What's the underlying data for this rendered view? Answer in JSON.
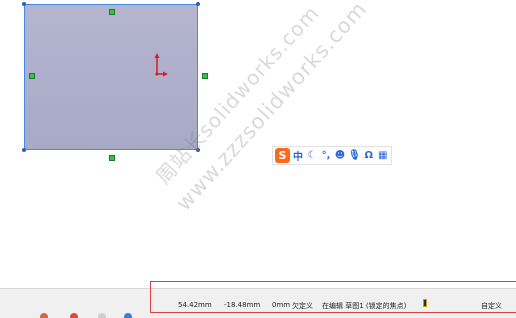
{
  "sketch": {
    "selected_color": "#3d8fe6",
    "fill_color": "#aeaecb",
    "handle_color": "#2fc44a",
    "origin_color": "#d42020"
  },
  "ime_toolbar": {
    "logo": "S",
    "items": [
      {
        "icon": "chinese-mode-icon",
        "label": "中"
      },
      {
        "icon": "moon-icon",
        "label": "☾"
      },
      {
        "icon": "punctuation-icon",
        "label": "°,"
      },
      {
        "icon": "emoji-icon",
        "label": "☻"
      },
      {
        "icon": "microphone-icon",
        "label": "🎙"
      },
      {
        "icon": "omega-icon",
        "label": "Ω"
      },
      {
        "icon": "grid-icon",
        "label": "▦"
      }
    ]
  },
  "watermark": {
    "line1": "周站长solidworks.com",
    "line2": "www.zzzsolidworks.com"
  },
  "status_bar": {
    "x_coord": "54.42mm",
    "y_coord": "-18.48mm",
    "z_coord": "0mm",
    "definition_state": "欠定义",
    "editing_status": "在编辑 草图1 (锁定的焦点)",
    "units": "自定义",
    "highlight_color": "#d9433f"
  }
}
